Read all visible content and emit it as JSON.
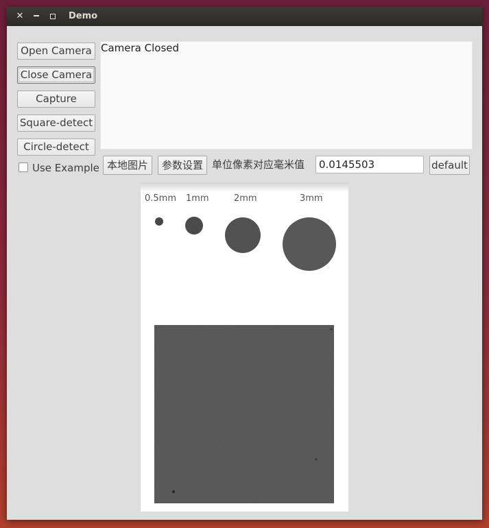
{
  "window": {
    "title": "Demo"
  },
  "titlebar": {
    "close_glyph": "✕"
  },
  "left_panel": {
    "open_camera": "Open Camera",
    "close_camera": "Close Camera",
    "capture": "Capture",
    "square_detect": "Square-detect",
    "circle_detect": "Circle-detect",
    "use_example": "Use Example",
    "use_example_checked": false
  },
  "status": {
    "text": "Camera Closed"
  },
  "controls": {
    "local_image": "本地图片",
    "param_settings": "参数设置",
    "mm_per_pixel_label": "单位像素对应毫米值",
    "mm_per_pixel_value": "0.0145503",
    "default_button": "default"
  },
  "image": {
    "labels": [
      "0.5mm",
      "1mm",
      "2mm",
      "3mm"
    ]
  },
  "icons": {
    "close": "close-icon",
    "minimize": "minimize-icon",
    "maximize": "maximize-icon"
  }
}
